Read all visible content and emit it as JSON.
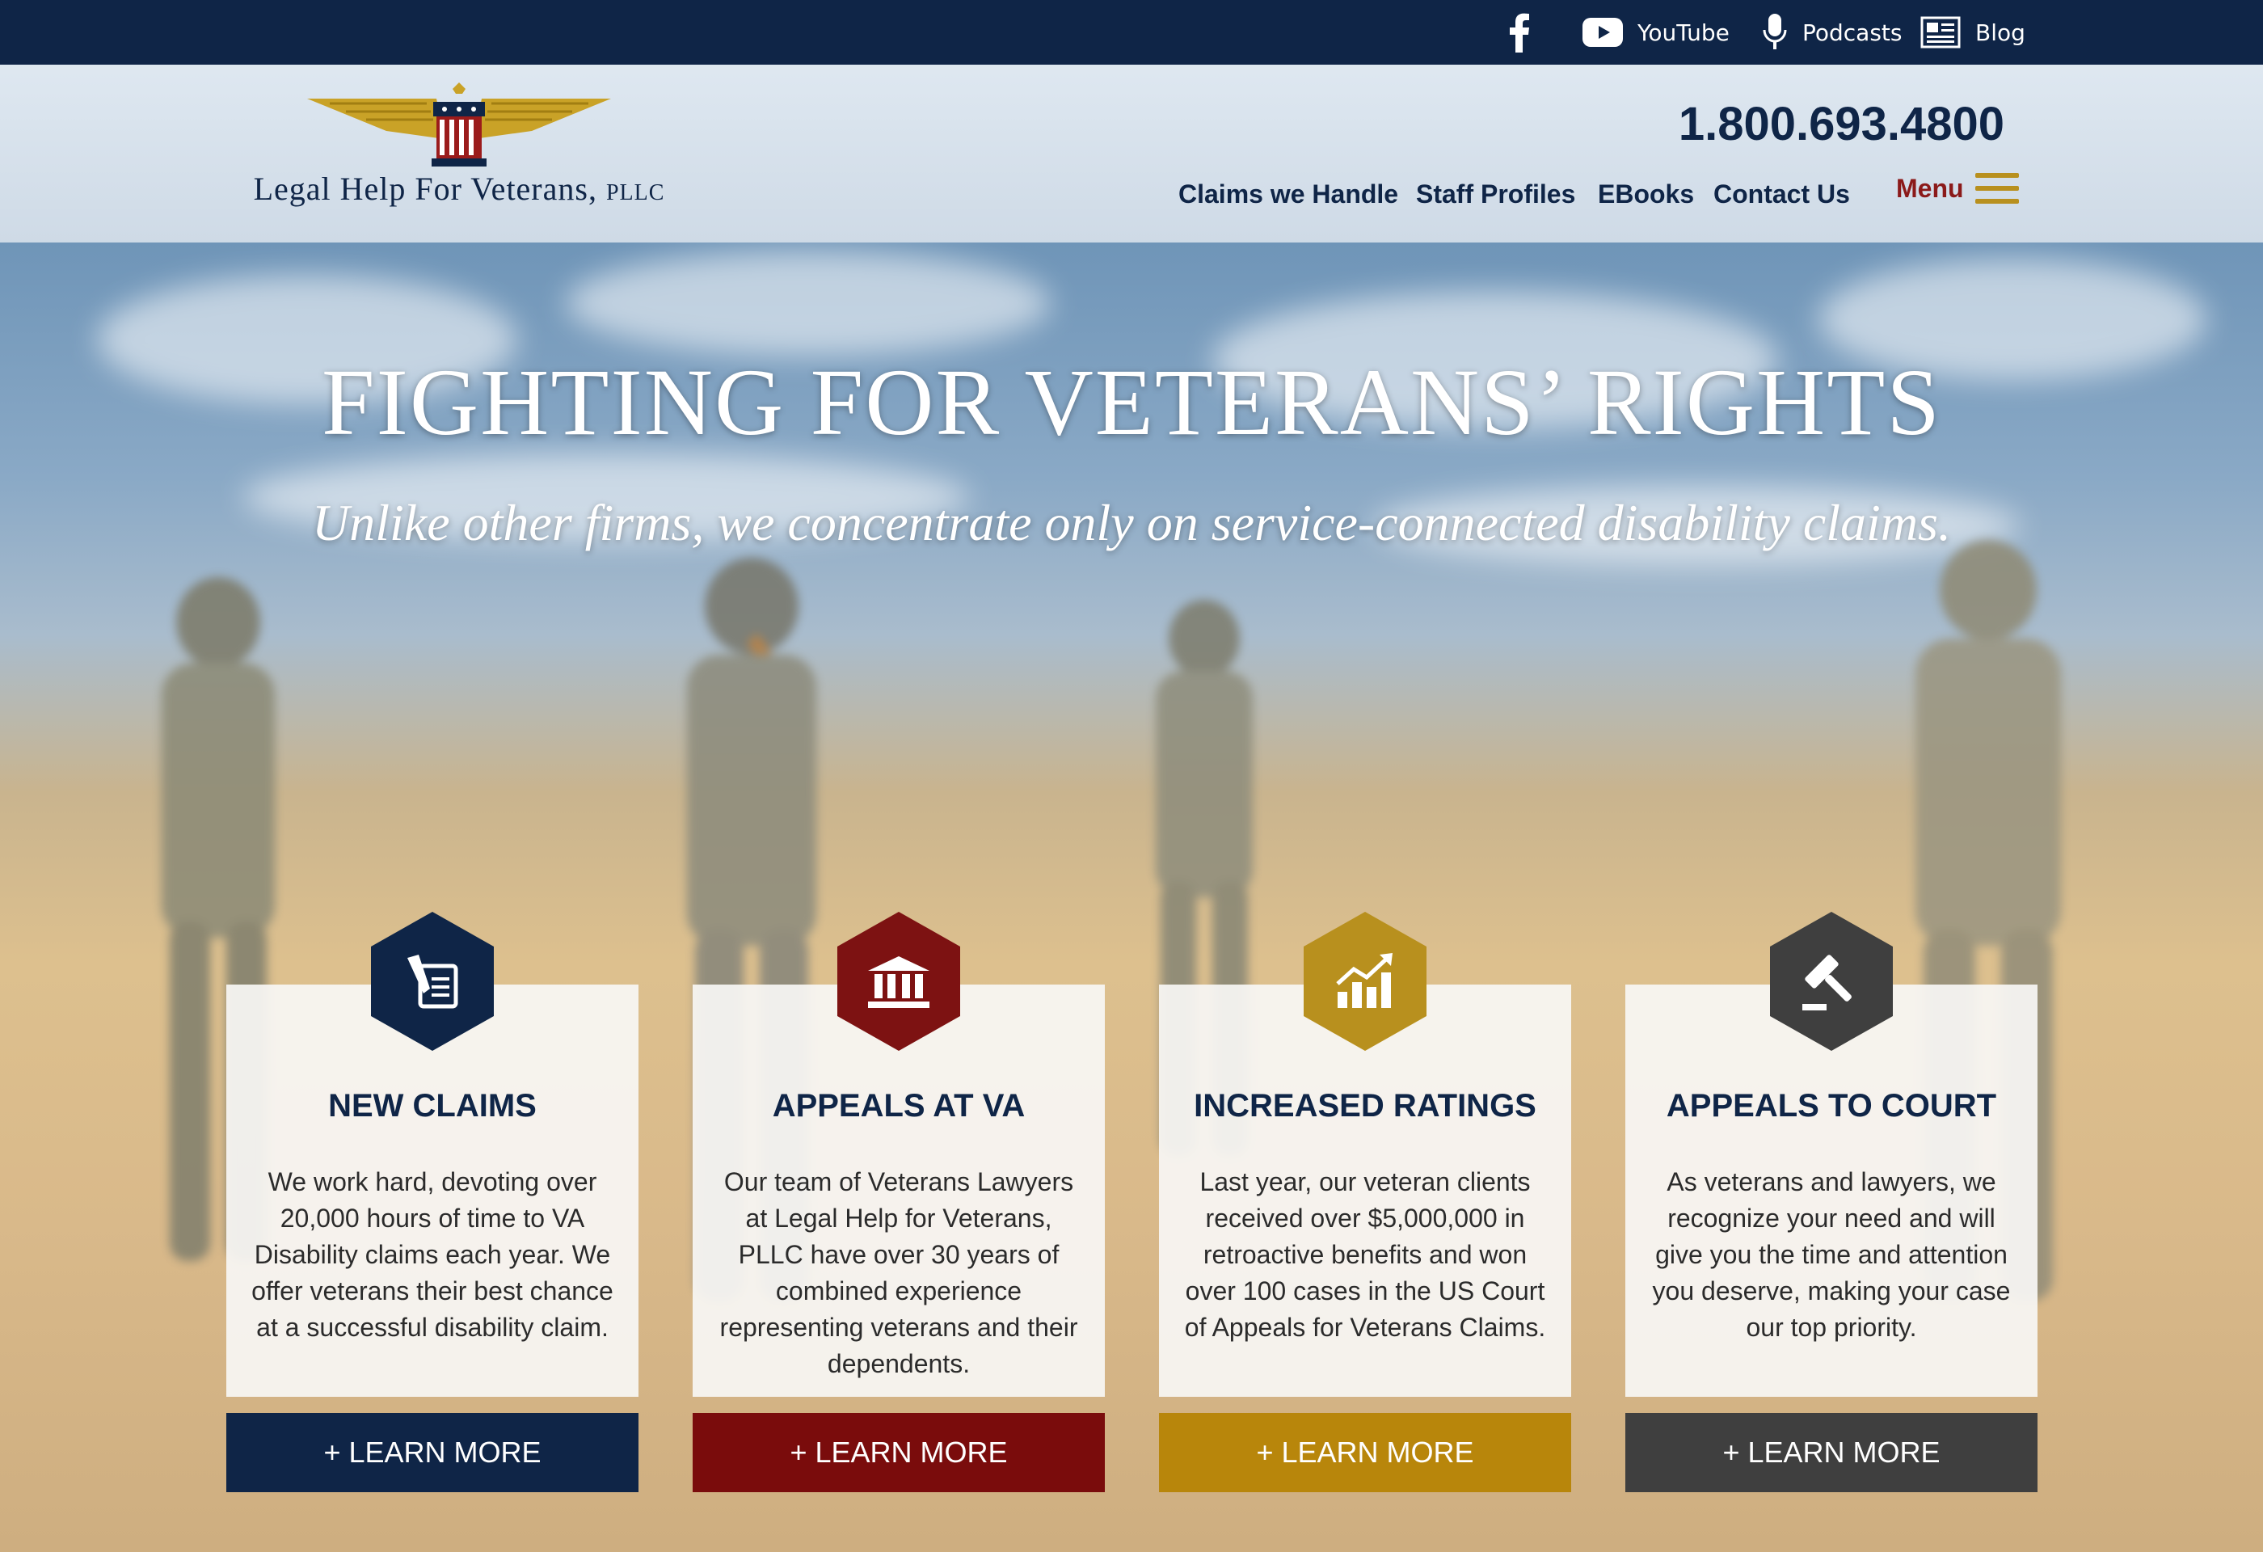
{
  "topbar": {
    "youtube_label": "YouTube",
    "podcasts_label": "Podcasts",
    "blog_label": "Blog",
    "icons": [
      "facebook-icon",
      "youtube-icon",
      "microphone-icon",
      "newspaper-icon"
    ]
  },
  "header": {
    "logo_name": "Legal Help For Veterans,",
    "logo_suffix": "PLLC",
    "phone": "1.800.693.4800",
    "nav": {
      "claims": "Claims we Handle",
      "staff": "Staff Profiles",
      "ebooks": "EBooks",
      "contact": "Contact Us"
    },
    "menu_label": "Menu"
  },
  "hero": {
    "title": "FIGHTING FOR VETERANS’ RIGHTS",
    "subtitle": "Unlike other firms, we concentrate only on service-connected disability claims."
  },
  "cards": [
    {
      "title": "NEW CLAIMS",
      "text": "We work hard, devoting over 20,000 hours of time to VA Disability claims each year. We offer veterans their best chance at a successful disability claim.",
      "button": "+ LEARN MORE",
      "icon": "document-sign-icon",
      "color": "#0f2547"
    },
    {
      "title": "APPEALS AT VA",
      "text": "Our team of Veterans Lawyers at Legal Help for Veterans, PLLC have over 30 years of combined experience representing veterans and their dependents.",
      "button": "+ LEARN MORE",
      "icon": "courthouse-icon",
      "color": "#7d1212"
    },
    {
      "title": "INCREASED RATINGS",
      "text": "Last year, our veteran clients received over $5,000,000 in retroactive benefits and won over 100 cases in the US Court of Appeals for Veterans Claims.",
      "button": "+ LEARN MORE",
      "icon": "chart-up-icon",
      "color": "#b8901e"
    },
    {
      "title": "APPEALS TO COURT",
      "text": "As veterans and lawyers, we recognize your need and will give you the time and attention you deserve, making your case our top priority.",
      "button": "+ LEARN MORE",
      "icon": "gavel-icon",
      "color": "#3f3f3f"
    }
  ]
}
